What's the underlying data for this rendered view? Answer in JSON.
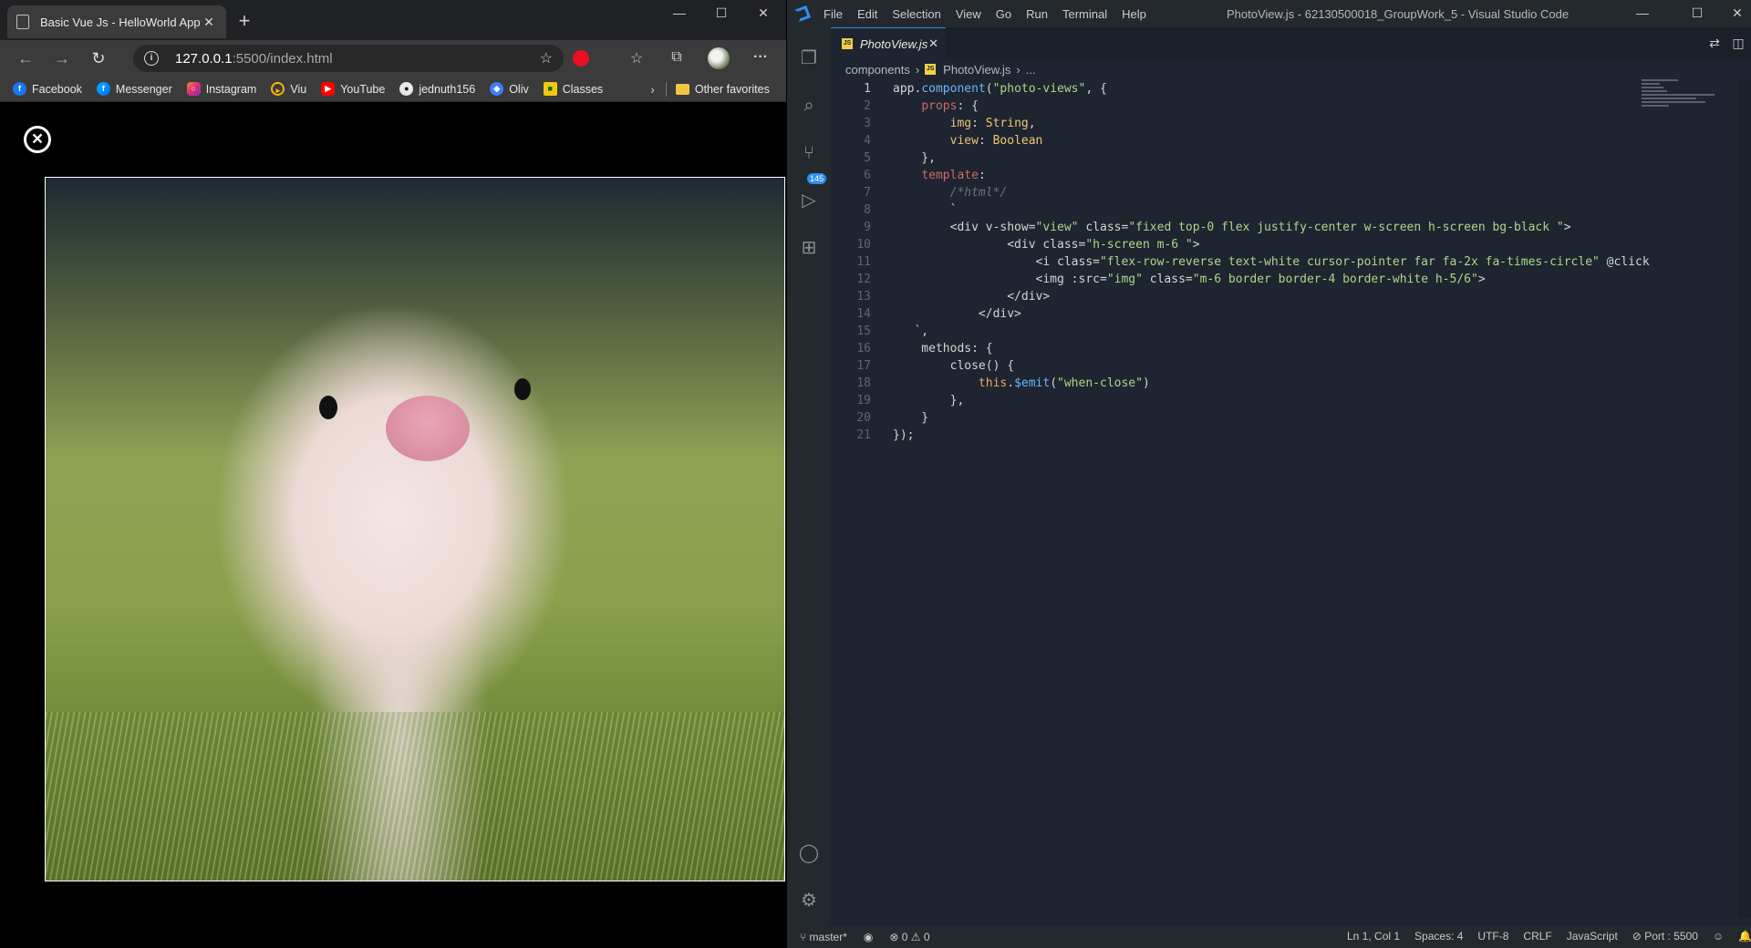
{
  "browser": {
    "tab_title": "Basic Vue Js - HelloWorld App",
    "address": {
      "host": "127.0.0.1",
      "rest": ":5500/index.html"
    },
    "bookmarks": [
      "Facebook",
      "Messenger",
      "Instagram",
      "Viu",
      "YouTube",
      "jednuth156",
      "Oliv",
      "Classes"
    ],
    "other_favorites": "Other favorites"
  },
  "vscode": {
    "menu": [
      "File",
      "Edit",
      "Selection",
      "View",
      "Go",
      "Run",
      "Terminal",
      "Help"
    ],
    "window_title": "PhotoView.js - 62130500018_GroupWork_5 - Visual Studio Code",
    "tab": "PhotoView.js",
    "scm_badge": "145",
    "breadcrumbs": [
      "components",
      "PhotoView.js",
      "..."
    ],
    "status": {
      "branch": "master*",
      "problems": "0 ⚠ 0",
      "position": "Ln 1, Col 1",
      "spaces": "Spaces: 4",
      "encoding": "UTF-8",
      "eol": "CRLF",
      "language": "JavaScript",
      "port": "Port : 5500"
    }
  },
  "code_lines": [
    "app.component(\"photo-views\", {",
    "    props: {",
    "        img: String,",
    "        view: Boolean",
    "    },",
    "    template:",
    "        /*html*/",
    "        `",
    "        <div v-show=\"view\" class=\"fixed top-0 flex justify-center w-screen h-screen bg-black \">",
    "                <div class=\"h-screen m-6 \">",
    "                    <i class=\"flex-row-reverse text-white cursor-pointer far fa-2x fa-times-circle\" @click",
    "                    <img :src=\"img\" class=\"m-6 border border-4 border-white h-5/6\">",
    "                </div>",
    "            </div>",
    "   `,",
    "    methods: {",
    "        close() {",
    "            this.$emit(\"when-close\")",
    "        },",
    "    }",
    "});"
  ]
}
